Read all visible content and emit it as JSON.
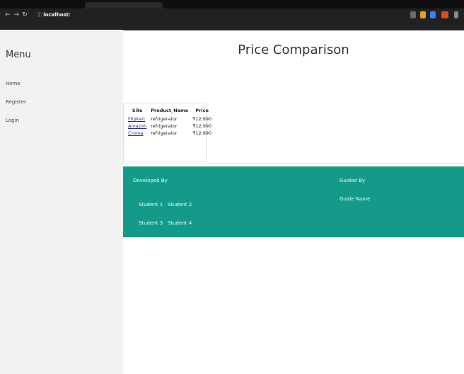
{
  "browser": {
    "url_host": "localhost",
    "url_path": "/",
    "extension_colors": [
      "#6b6b6b",
      "#e8a317",
      "#3b82f6",
      "#e24a1b",
      "#8a8a8a"
    ]
  },
  "sidebar": {
    "title": "Menu",
    "items": [
      {
        "label": "Home"
      },
      {
        "label": "Register"
      },
      {
        "label": "Login"
      }
    ]
  },
  "main": {
    "title": "Price Comparison",
    "table": {
      "headers": [
        "Site",
        "Product_Name",
        "Price"
      ],
      "rows": [
        {
          "site": "Flipkart",
          "product": "refrigerator",
          "price": "₹12,990"
        },
        {
          "site": "Amazon",
          "product": "refrigerator",
          "price": "₹12,990"
        },
        {
          "site": "Croma",
          "product": "refrigerator",
          "price": "₹12,990"
        }
      ]
    }
  },
  "footer": {
    "developed_by_label": "Developed By",
    "students": [
      "Student 1",
      "Student 2",
      "Student 3",
      "Student 4"
    ],
    "guided_by_label": "Guided By",
    "guide_name": "Guide Name",
    "background": "#139a89"
  }
}
